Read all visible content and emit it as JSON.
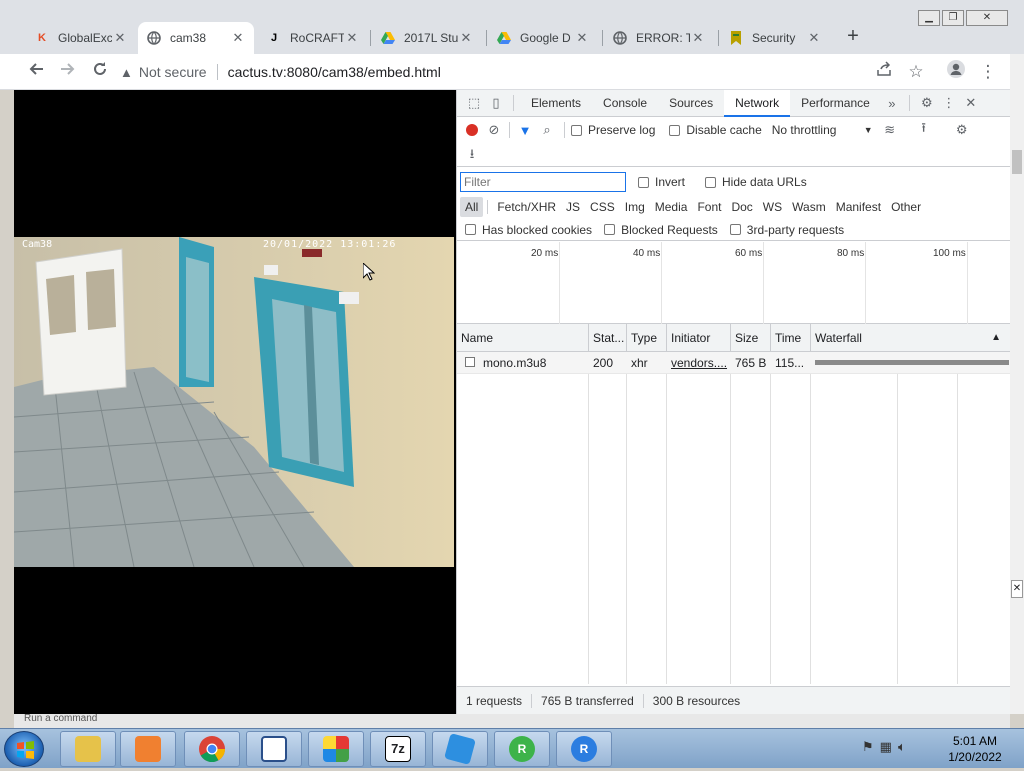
{
  "tabs": [
    {
      "title": "GlobalExc",
      "favicon": "K",
      "color": "#e44d26",
      "active": false
    },
    {
      "title": "cam38",
      "favicon": "globe-icon",
      "color": "#5f6368",
      "active": true
    },
    {
      "title": "RoCRAFT",
      "favicon": "J",
      "color": "#000000",
      "active": false
    },
    {
      "title": "2017L Stu",
      "favicon": "drive-icon",
      "color": "#fbbc04",
      "active": false
    },
    {
      "title": "Google D",
      "favicon": "drive-icon",
      "color": "#fbbc04",
      "active": false
    },
    {
      "title": "ERROR: T",
      "favicon": "globe-icon",
      "color": "#5f6368",
      "active": false
    },
    {
      "title": "Security",
      "favicon": "bookmark-icon",
      "color": "#b8a000",
      "active": false
    }
  ],
  "toolbar": {
    "security_label": "Not secure",
    "url": "cactus.tv:8080/cam38/embed.html"
  },
  "camera": {
    "label": "Cam38",
    "timestamp": "20/01/2022 13:01:26"
  },
  "devtools": {
    "tabs": [
      "Elements",
      "Console",
      "Sources",
      "Network",
      "Performance"
    ],
    "active_tab": "Network",
    "preserve_log": "Preserve log",
    "disable_cache": "Disable cache",
    "throttling": "No throttling",
    "filter_placeholder": "Filter",
    "invert": "Invert",
    "hide_data_urls": "Hide data URLs",
    "types": [
      "All",
      "Fetch/XHR",
      "JS",
      "CSS",
      "Img",
      "Media",
      "Font",
      "Doc",
      "WS",
      "Wasm",
      "Manifest",
      "Other"
    ],
    "has_blocked_cookies": "Has blocked cookies",
    "blocked_requests": "Blocked Requests",
    "third_party": "3rd-party requests",
    "overview_ticks": [
      "20 ms",
      "40 ms",
      "60 ms",
      "80 ms",
      "100 ms"
    ],
    "columns": [
      "Name",
      "Stat...",
      "Type",
      "Initiator",
      "Size",
      "Time",
      "Waterfall"
    ],
    "rows": [
      {
        "name": "mono.m3u8",
        "status": "200",
        "type": "xhr",
        "initiator": "vendors....",
        "size": "765 B",
        "time": "115..."
      }
    ],
    "status": {
      "requests": "1 requests",
      "transferred": "765 B transferred",
      "resources": "300 B resources"
    }
  },
  "cmdbar": {
    "text": "Run a command"
  },
  "taskbar": {
    "time": "5:01 AM",
    "date": "1/20/2022"
  }
}
